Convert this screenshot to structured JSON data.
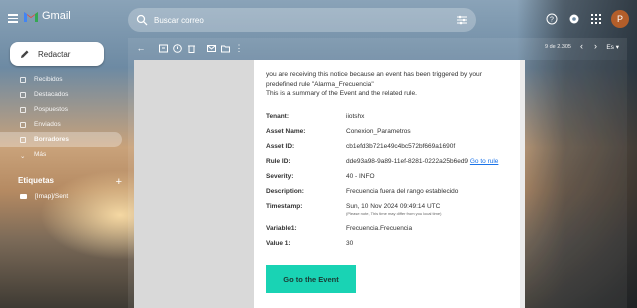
{
  "app": {
    "name": "Gmail",
    "avatar": "P"
  },
  "search": {
    "placeholder": "Buscar correo"
  },
  "compose": {
    "label": "Redactar"
  },
  "nav": [
    {
      "label": "Recibidos",
      "count": "",
      "active": false
    },
    {
      "label": "Destacados",
      "count": "",
      "active": false
    },
    {
      "label": "Pospuestos",
      "count": "",
      "active": false
    },
    {
      "label": "Enviados",
      "count": "",
      "active": false
    },
    {
      "label": "Borradores",
      "count": "",
      "active": true
    },
    {
      "label": "Más",
      "count": "",
      "active": false
    }
  ],
  "labels": {
    "title": "Etiquetas",
    "plus": "+",
    "items": [
      {
        "label": "[Imap]/Sent"
      }
    ]
  },
  "toolbar": {
    "pager": "9 de 2.305",
    "lang": "Es"
  },
  "email": {
    "intro_line1": "you are receiving this notice because an event has been triggered by your",
    "intro_line2": "predefined rule \"Alarma_Frecuencia\"",
    "intro_line3": "This is a summary of the Event and the related rule.",
    "rows": [
      {
        "label": "Tenant:",
        "value": "iiotshx"
      },
      {
        "label": "Asset Name:",
        "value": "Conexion_Parametros"
      },
      {
        "label": "Asset ID:",
        "value": "cb1efd3b721e49c4bc572bf669a1690f"
      },
      {
        "label": "Rule ID:",
        "value": "dde93a98-9a89-11ef-8281-0222a25b6ed9",
        "link": "Go to rule"
      },
      {
        "label": "Severity:",
        "value": "40 - INFO"
      },
      {
        "label": "Description:",
        "value": "Frecuencia fuera del rango establecido"
      },
      {
        "label": "Timestamp:",
        "value": "Sun, 10 Nov 2024 09:49:14 UTC",
        "note": "(Please note, This time may differ from you local time)"
      },
      {
        "label": "Variable1:",
        "value": "Frecuencia.Frecuencia"
      },
      {
        "label": "Value 1:",
        "value": "30"
      }
    ],
    "cta": "Go to the Event"
  }
}
